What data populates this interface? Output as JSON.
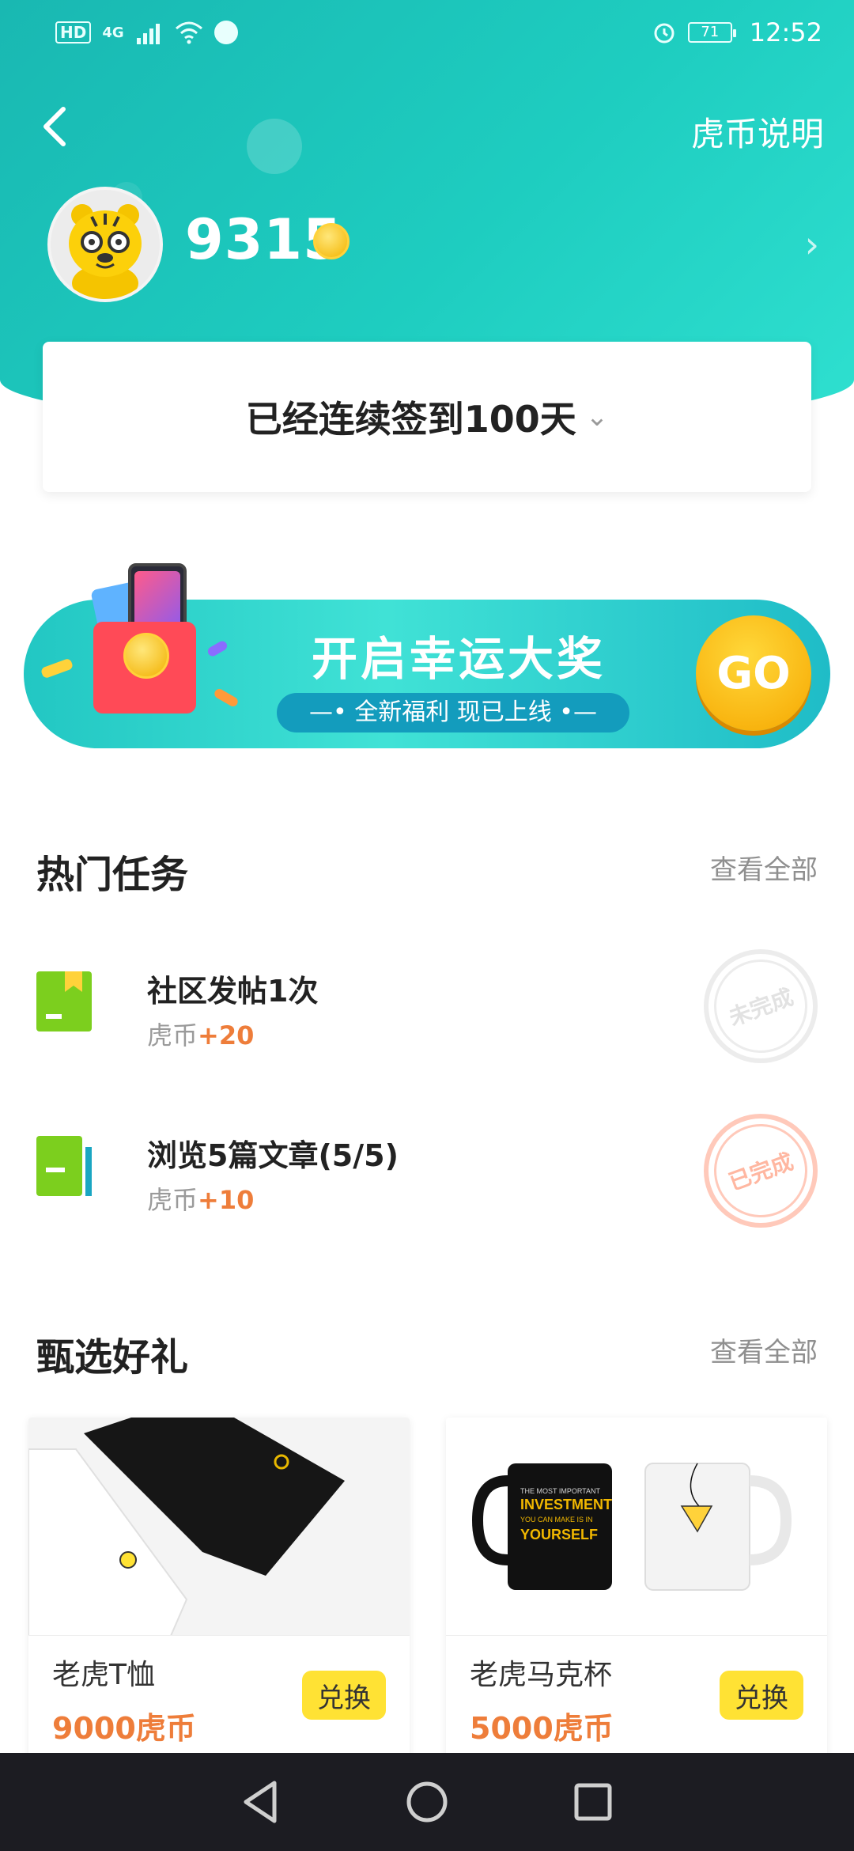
{
  "status_bar": {
    "left_icons": [
      "HD",
      "4G",
      "signal",
      "wifi",
      "app"
    ],
    "time": "12:52",
    "battery": "71"
  },
  "header": {
    "help_link": "虎币说明",
    "coin_balance": "9315"
  },
  "checkin": {
    "text": "已经连续签到100天"
  },
  "banner": {
    "title": "开启幸运大奖",
    "subtitle": "—• 全新福利 现已上线 •—",
    "go_label": "GO"
  },
  "hot_tasks": {
    "title": "热门任务",
    "more": "查看全部",
    "items": [
      {
        "title": "社区发帖1次",
        "reward_prefix": "虎币",
        "reward": "+20",
        "status": "未完成"
      },
      {
        "title": "浏览5篇文章(5/5)",
        "reward_prefix": "虎币",
        "reward": "+10",
        "status": "已完成"
      }
    ]
  },
  "gifts": {
    "title": "甄选好礼",
    "more": "查看全部",
    "items": [
      {
        "name": "老虎T恤",
        "price": "9000虎币",
        "action": "兑换"
      },
      {
        "name": "老虎马克杯",
        "price": "5000虎币",
        "action": "兑换",
        "mug_lines": [
          "THE MOST IMPORTANT",
          "INVESTMENT",
          "YOU CAN MAKE IS IN",
          "YOURSELF"
        ]
      }
    ]
  },
  "colors": {
    "header_teal": "#1ecdc0",
    "accent_orange": "#ee7d3a",
    "redeem_yellow": "#ffe234",
    "go_yellow": "#f6b400"
  }
}
